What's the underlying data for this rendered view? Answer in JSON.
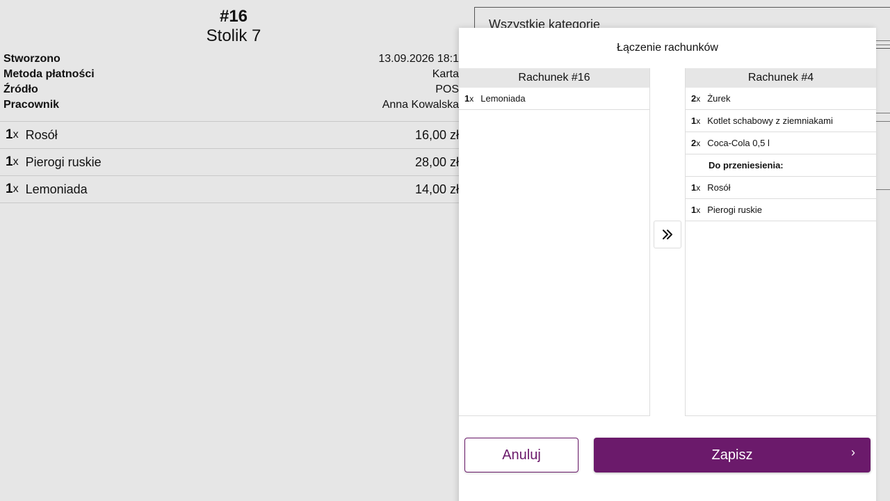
{
  "receipt": {
    "order_no": "#16",
    "table": "Stolik 7",
    "meta": [
      {
        "label": "Stworzono",
        "value": "13.09.2026 18:1"
      },
      {
        "label": "Metoda płatności",
        "value": "Karta"
      },
      {
        "label": "Źródło",
        "value": "POS"
      },
      {
        "label": "Pracownik",
        "value": "Anna Kowalska"
      }
    ],
    "items": [
      {
        "qty": "1",
        "x": "x",
        "name": "Rosół",
        "price": "16,00 zł"
      },
      {
        "qty": "1",
        "x": "x",
        "name": "Pierogi ruskie",
        "price": "28,00 zł"
      },
      {
        "qty": "1",
        "x": "x",
        "name": "Lemoniada",
        "price": "14,00 zł"
      }
    ]
  },
  "category_filter": {
    "label": "Wszystkie kategorie"
  },
  "modal": {
    "title": "Łączenie rachunków",
    "left_panel": {
      "title": "Rachunek #16",
      "items": [
        {
          "qty": "1",
          "x": "x",
          "name": "Lemoniada"
        }
      ]
    },
    "move_icon": "double-chevron-right-icon",
    "right_panel": {
      "title": "Rachunek #4",
      "items": [
        {
          "qty": "2",
          "x": "x",
          "name": "Żurek"
        },
        {
          "qty": "1",
          "x": "x",
          "name": "Kotlet schabowy z ziemniakami"
        },
        {
          "qty": "2",
          "x": "x",
          "name": "Coca-Cola 0,5 l"
        }
      ],
      "transfer_label": "Do przeniesienia:",
      "transfer_items": [
        {
          "qty": "1",
          "x": "x",
          "name": "Rosół"
        },
        {
          "qty": "1",
          "x": "x",
          "name": "Pierogi ruskie"
        }
      ]
    },
    "cancel_label": "Anuluj",
    "save_label": "Zapisz",
    "save_chevron": "›"
  },
  "colors": {
    "primary": "#6b1a6b",
    "background": "#e6e6e6",
    "header_bg": "#e6e6e6"
  }
}
